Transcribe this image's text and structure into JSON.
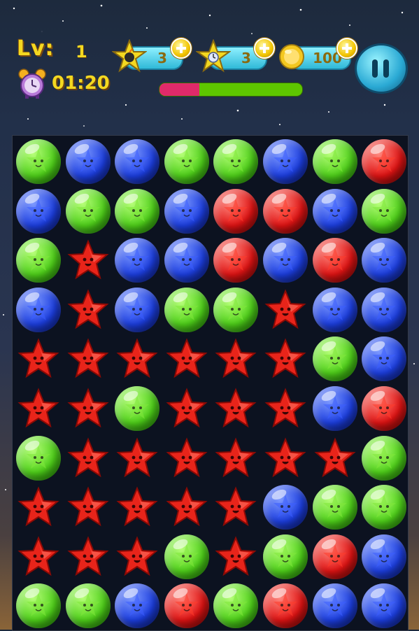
{
  "hud": {
    "level_label": "Lv:",
    "level_value": "1",
    "timer": "01:20",
    "items": [
      {
        "name": "bomb-star",
        "count": "3"
      },
      {
        "name": "clock-star",
        "count": "3"
      },
      {
        "name": "coins",
        "count": "100"
      }
    ],
    "progress": 0.28,
    "colors": {
      "accent": "#f4d820",
      "progress_fill": "#e02a6a",
      "progress_track": "#5ec600"
    }
  },
  "board": {
    "rows": 10,
    "cols": 8,
    "legend": {
      "G": "green-gem",
      "B": "blue-gem",
      "R": "red-gem",
      "S": "red-star"
    },
    "grid": [
      [
        "G",
        "B",
        "B",
        "G",
        "G",
        "B",
        "G",
        "R"
      ],
      [
        "B",
        "G",
        "G",
        "B",
        "R",
        "R",
        "B",
        "G"
      ],
      [
        "G",
        "S",
        "B",
        "B",
        "R",
        "B",
        "R",
        "B"
      ],
      [
        "B",
        "S",
        "B",
        "G",
        "G",
        "S",
        "B",
        "B"
      ],
      [
        "S",
        "S",
        "S",
        "S",
        "S",
        "S",
        "G",
        "B"
      ],
      [
        "S",
        "S",
        "G",
        "S",
        "S",
        "S",
        "B",
        "R"
      ],
      [
        "G",
        "S",
        "S",
        "S",
        "S",
        "S",
        "S",
        "G"
      ],
      [
        "S",
        "S",
        "S",
        "S",
        "S",
        "B",
        "G",
        "G"
      ],
      [
        "S",
        "S",
        "S",
        "G",
        "S",
        "G",
        "R",
        "B"
      ],
      [
        "G",
        "G",
        "B",
        "R",
        "G",
        "R",
        "B",
        "B"
      ]
    ]
  }
}
